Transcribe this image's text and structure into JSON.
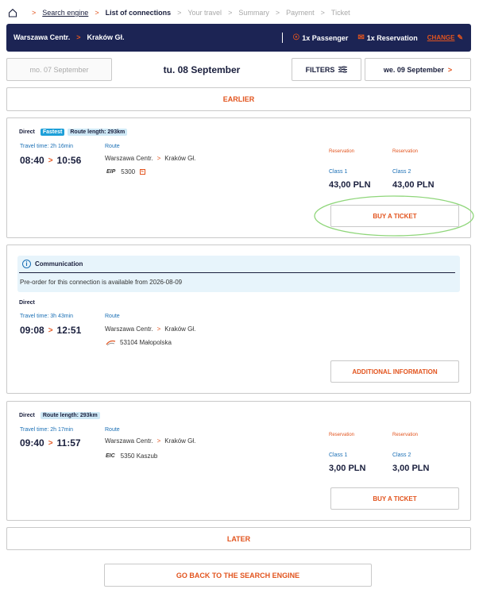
{
  "breadcrumb": {
    "items": [
      {
        "label": "Search engine",
        "state": "done"
      },
      {
        "label": "List of connections",
        "state": "current"
      },
      {
        "label": "Your travel",
        "state": "future"
      },
      {
        "label": "Summary",
        "state": "future"
      },
      {
        "label": "Payment",
        "state": "future"
      },
      {
        "label": "Ticket",
        "state": "future"
      }
    ]
  },
  "topbar": {
    "from": "Warszawa Centr.",
    "to": "Kraków Gł.",
    "passengers": "1x Passenger",
    "reservations": "1x Reservation",
    "change_label": "CHANGE"
  },
  "dates": {
    "prev": "mo. 07 September",
    "current": "tu. 08 September",
    "filters": "FILTERS",
    "next": "we. 09 September"
  },
  "earlier_label": "EARLIER",
  "later_label": "LATER",
  "go_back_label": "GO BACK TO THE SEARCH ENGINE",
  "connections": [
    {
      "type": "Direct",
      "badge_fastest": "Fastest",
      "route_length": "Route length: 293km",
      "travel_time": "Travel time: 2h 16min",
      "depart": "08:40",
      "arrive": "10:56",
      "route_label": "Route",
      "from": "Warszawa Centr.",
      "to": "Kraków Gł.",
      "train_logo": "EIP",
      "train": "5300",
      "reservation1": "Reservation",
      "reservation2": "Reservation",
      "class1": "Class 1",
      "class2": "Class 2",
      "price1": "43,00 PLN",
      "price2": "43,00 PLN",
      "button": "BUY A TICKET"
    },
    {
      "communication_title": "Communication",
      "communication_text": "Pre-order for this connection is available from 2026-08-09",
      "type": "Direct",
      "travel_time": "Travel time: 3h 43min",
      "depart": "09:08",
      "arrive": "12:51",
      "route_label": "Route",
      "from": "Warszawa Centr.",
      "to": "Kraków Gł.",
      "train": "53104 Małopolska",
      "button": "ADDITIONAL INFORMATION"
    },
    {
      "type": "Direct",
      "route_length": "Route length: 293km",
      "travel_time": "Travel time: 2h 17min",
      "depart": "09:40",
      "arrive": "11:57",
      "route_label": "Route",
      "from": "Warszawa Centr.",
      "to": "Kraków Gł.",
      "train_logo": "EIC",
      "train": "5350 Kaszub",
      "reservation1": "Reservation",
      "reservation2": "Reservation",
      "class1": "Class 1",
      "class2": "Class 2",
      "price1": "3,00 PLN",
      "price2": "3,00 PLN",
      "button": "BUY A TICKET"
    }
  ],
  "colors": {
    "navy": "#1c2454",
    "accent": "#e2541e",
    "blue": "#1a6fb5",
    "badge_fast": "#1d9fd8",
    "info_bg": "#e7f4fb",
    "highlight": "#8fd67a"
  }
}
